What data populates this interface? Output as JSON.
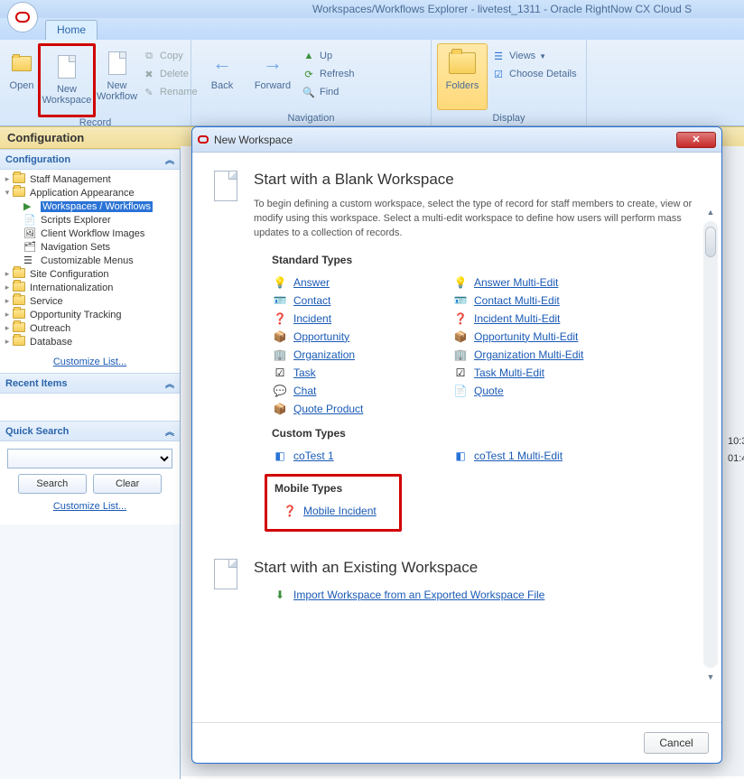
{
  "window": {
    "title": "Workspaces/Workflows Explorer  - livetest_1311 - Oracle RightNow CX Cloud S"
  },
  "tabs": {
    "home": "Home"
  },
  "ribbon": {
    "open": "Open",
    "new_workspace_l1": "New",
    "new_workspace_l2": "Workspace",
    "new_workflow_l1": "New",
    "new_workflow_l2": "Workflow",
    "copy": "Copy",
    "delete": "Delete",
    "rename": "Rename",
    "record_group": "Record",
    "back": "Back",
    "forward": "Forward",
    "up": "Up",
    "refresh": "Refresh",
    "find": "Find",
    "navigation_group": "Navigation",
    "folders": "Folders",
    "views": "Views",
    "choose_details": "Choose Details",
    "display_group": "Display"
  },
  "config": {
    "header": "Configuration",
    "section": "Configuration",
    "tree": {
      "staff": "Staff Management",
      "appearance": "Application Appearance",
      "workspaces": "Workspaces / Workflows",
      "scripts": "Scripts Explorer",
      "cwimages": "Client Workflow Images",
      "navsets": "Navigation Sets",
      "menus": "Customizable Menus",
      "siteconfig": "Site Configuration",
      "intl": "Internationalization",
      "service": "Service",
      "opptrack": "Opportunity Tracking",
      "outreach": "Outreach",
      "database": "Database"
    },
    "customize": "Customize List...",
    "recent": "Recent Items",
    "quicksearch": "Quick Search",
    "search_btn": "Search",
    "clear_btn": "Clear",
    "customize2": "Customize List..."
  },
  "dialog": {
    "title": "New Workspace",
    "blank_heading": "Start with a Blank Workspace",
    "blank_desc": "To begin defining a custom workspace, select the type of record for staff members to create, view or modify using this workspace. Select a multi-edit workspace to define how users will perform mass updates to a collection of records.",
    "standard_heading": "Standard Types",
    "standard_left": [
      "Answer",
      "Contact",
      "Incident",
      "Opportunity",
      "Organization",
      "Task",
      "Chat",
      "Quote Product"
    ],
    "standard_right": [
      "Answer Multi-Edit",
      "Contact Multi-Edit",
      "Incident Multi-Edit",
      "Opportunity Multi-Edit",
      "Organization Multi-Edit",
      "Task Multi-Edit",
      "Quote"
    ],
    "custom_heading": "Custom Types",
    "custom_left": [
      "coTest 1"
    ],
    "custom_right": [
      "coTest 1 Multi-Edit"
    ],
    "mobile_heading": "Mobile Types",
    "mobile_items": [
      "Mobile Incident"
    ],
    "existing_heading": "Start with an Existing Workspace",
    "import_link": "Import Workspace from an Exported Workspace File",
    "cancel": "Cancel"
  },
  "rightstub": {
    "t1": "10:3",
    "t2": "01:4"
  }
}
